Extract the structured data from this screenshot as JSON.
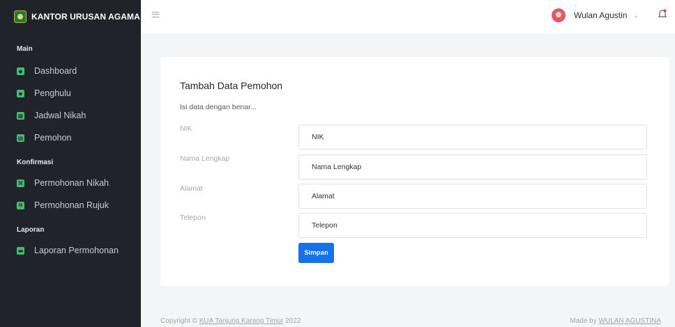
{
  "app": {
    "title": "KANTOR URUSAN AGAMA"
  },
  "sidebar": {
    "sections": [
      {
        "title": "Main",
        "items": [
          {
            "label": "Dashboard",
            "icon": "dashboard-icon"
          },
          {
            "label": "Penghulu",
            "icon": "id-card-icon"
          },
          {
            "label": "Jadwal Nikah",
            "icon": "calendar-icon"
          },
          {
            "label": "Pemohon",
            "icon": "contact-card-icon"
          }
        ]
      },
      {
        "title": "Konfirmasi",
        "items": [
          {
            "label": "Permohonan Nikah",
            "icon": "command-icon"
          },
          {
            "label": "Permohonan Rujuk",
            "icon": "flow-icon"
          }
        ]
      },
      {
        "title": "Laporan",
        "items": [
          {
            "label": "Laporan Permohonan",
            "icon": "printer-icon"
          }
        ]
      }
    ]
  },
  "header": {
    "user_name": "Wulan Agustin",
    "caret": "⌄"
  },
  "form": {
    "title": "Tambah Data Pemohon",
    "subtitle": "Isi data dengan benar...",
    "fields": [
      {
        "label": "NIK",
        "placeholder": "NIK"
      },
      {
        "label": "Nama Lengkap",
        "placeholder": "Nama Lengkap"
      },
      {
        "label": "Alamat",
        "placeholder": "Alamat"
      },
      {
        "label": "Telepon",
        "placeholder": "Telepon"
      }
    ],
    "submit_label": "Simpan"
  },
  "footer": {
    "copyright_prefix": "Copyright © ",
    "copyright_link": "KUA Tanjung Karang Timur",
    "copyright_year": " 2022",
    "made_by_prefix": "Made by ",
    "made_by_link": "WULAN AGUSTINA"
  },
  "colors": {
    "sidebar_bg": "#202329",
    "accent_green": "#3fbf73",
    "primary_button": "#1572e8",
    "content_bg": "#f4f5f7"
  }
}
